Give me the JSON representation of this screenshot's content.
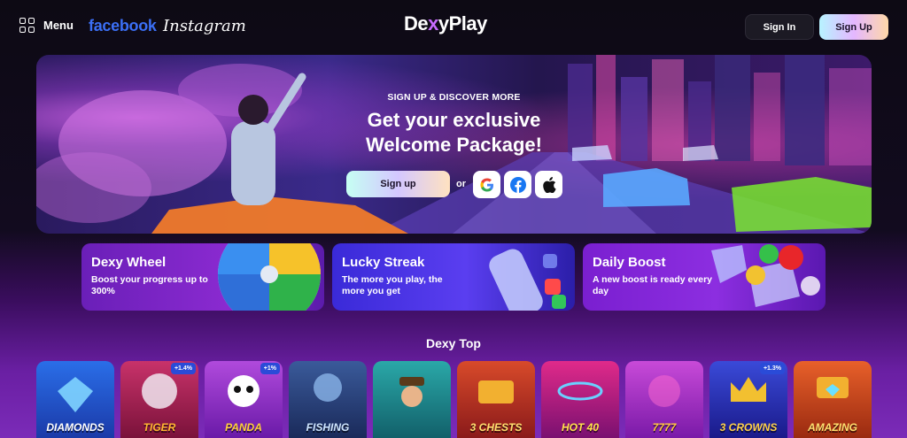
{
  "header": {
    "menu_label": "Menu",
    "facebook_logo": "facebook",
    "instagram_logo": "Instagram",
    "brand_part1": "De",
    "brand_x": "x",
    "brand_part2": "yPlay",
    "signin_label": "Sign In",
    "signup_label": "Sign Up"
  },
  "hero": {
    "eyebrow": "SIGN UP & DISCOVER MORE",
    "title_line1": "Get your exclusive",
    "title_line2": "Welcome Package!",
    "signup_label": "Sign up",
    "or_label": "or",
    "social": [
      "google-icon",
      "facebook-icon",
      "apple-icon"
    ]
  },
  "promos": [
    {
      "title": "Dexy Wheel",
      "desc": "Boost your progress up to 300%"
    },
    {
      "title": "Lucky Streak",
      "desc": "The more you play, the more you get"
    },
    {
      "title": "Daily Boost",
      "desc": "A new boost is ready every day"
    }
  ],
  "section_title": "Dexy Top",
  "games": [
    {
      "name": "DIAMONDS",
      "badge": ""
    },
    {
      "name": "TIGER",
      "badge": "+1.4%"
    },
    {
      "name": "PANDA",
      "badge": "+1%"
    },
    {
      "name": "FISHING",
      "badge": ""
    },
    {
      "name": "",
      "badge": ""
    },
    {
      "name": "3 CHESTS",
      "badge": ""
    },
    {
      "name": "HOT 40",
      "badge": ""
    },
    {
      "name": "7777",
      "badge": ""
    },
    {
      "name": "3 CROWNS",
      "badge": "+1.3%"
    },
    {
      "name": "AMAZING",
      "badge": ""
    }
  ],
  "colors": {
    "facebook_blue": "#3b6ff5",
    "accent_purple": "#7b2bb8",
    "badge_blue": "#2a4bd8"
  }
}
